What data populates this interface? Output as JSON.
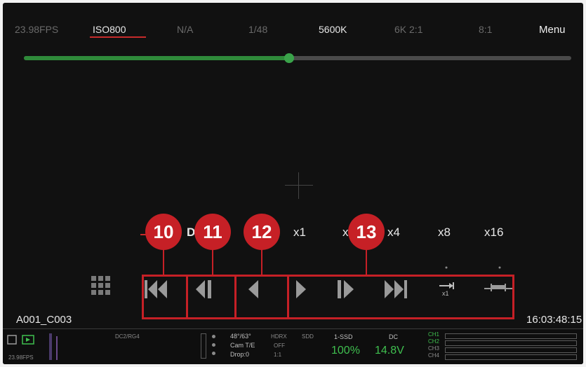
{
  "topbar": {
    "fps": "23.98FPS",
    "iso": "ISO800",
    "aperture": "N/A",
    "shutter": "1/48",
    "white_balance": "5600K",
    "resolution": "6K 2:1",
    "compression": "8:1",
    "menu": "Menu"
  },
  "timeline": {
    "progress": 0.485
  },
  "speeds": [
    "x1",
    "x2",
    "x4",
    "x8",
    "x16"
  ],
  "speed_partial": "D",
  "badges": [
    "10",
    "11",
    "12",
    "13"
  ],
  "controls": {
    "grid": "grid-icon",
    "skip_start": "skip-to-start-icon",
    "step_back": "step-back-icon",
    "play_reverse": "play-reverse-icon",
    "play": "play-icon",
    "step_forward": "step-forward-icon",
    "skip_end": "skip-to-end-icon",
    "loop": "loop-icon",
    "loop_label": "x1",
    "range": "range-icon"
  },
  "clip_name": "A001_C003",
  "timecode": "16:03:48:15",
  "bottombar": {
    "fps": "23.98FPS",
    "codec": "DC2/RG4",
    "angle": "48°/63°",
    "camera": "Cam T/E",
    "drop": "Drop:0",
    "hdrx": "HDRX",
    "off": "OFF",
    "s_val": "1:1",
    "sdd": "SDD",
    "media": "1-SSD",
    "media_pct": "100%",
    "power": "DC",
    "voltage": "14.8V",
    "channels": [
      "CH1",
      "CH2",
      "CH3",
      "CH4"
    ]
  },
  "colors": {
    "badge": "#c62026",
    "timeline_fill": "#2f8a3a",
    "status_green": "#3fbf4f"
  }
}
